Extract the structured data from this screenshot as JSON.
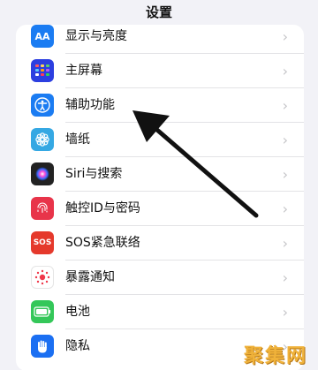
{
  "header": {
    "title": "设置"
  },
  "colors": {
    "background": "#f2f2f7",
    "arrow": "#111111",
    "watermark": "#f0b23a"
  },
  "settings": {
    "items": [
      {
        "label": "显示与亮度",
        "icon": "display-brightness-icon",
        "icon_text": "AA",
        "color": "#1b7cf2"
      },
      {
        "label": "主屏幕",
        "icon": "home-screen-icon",
        "icon_text": "",
        "color": "#2c3fe0"
      },
      {
        "label": "辅助功能",
        "icon": "accessibility-icon",
        "icon_text": "",
        "color": "#1b7cf2"
      },
      {
        "label": "墙纸",
        "icon": "wallpaper-icon",
        "icon_text": "",
        "color": "#35a8e3"
      },
      {
        "label": "Siri与搜索",
        "icon": "siri-icon",
        "icon_text": "",
        "color": "#222222"
      },
      {
        "label": "触控ID与密码",
        "icon": "touch-id-icon",
        "icon_text": "",
        "color": "#e8344a"
      },
      {
        "label": "SOS紧急联络",
        "icon": "sos-icon",
        "icon_text": "SOS",
        "color": "#e5392c"
      },
      {
        "label": "暴露通知",
        "icon": "exposure-notification-icon",
        "icon_text": "",
        "color": "#ffffff"
      },
      {
        "label": "电池",
        "icon": "battery-icon",
        "icon_text": "",
        "color": "#34c759"
      },
      {
        "label": "隐私",
        "icon": "privacy-hand-icon",
        "icon_text": "",
        "color": "#1b6ff2"
      }
    ]
  },
  "watermark": {
    "text": "聚集网"
  }
}
